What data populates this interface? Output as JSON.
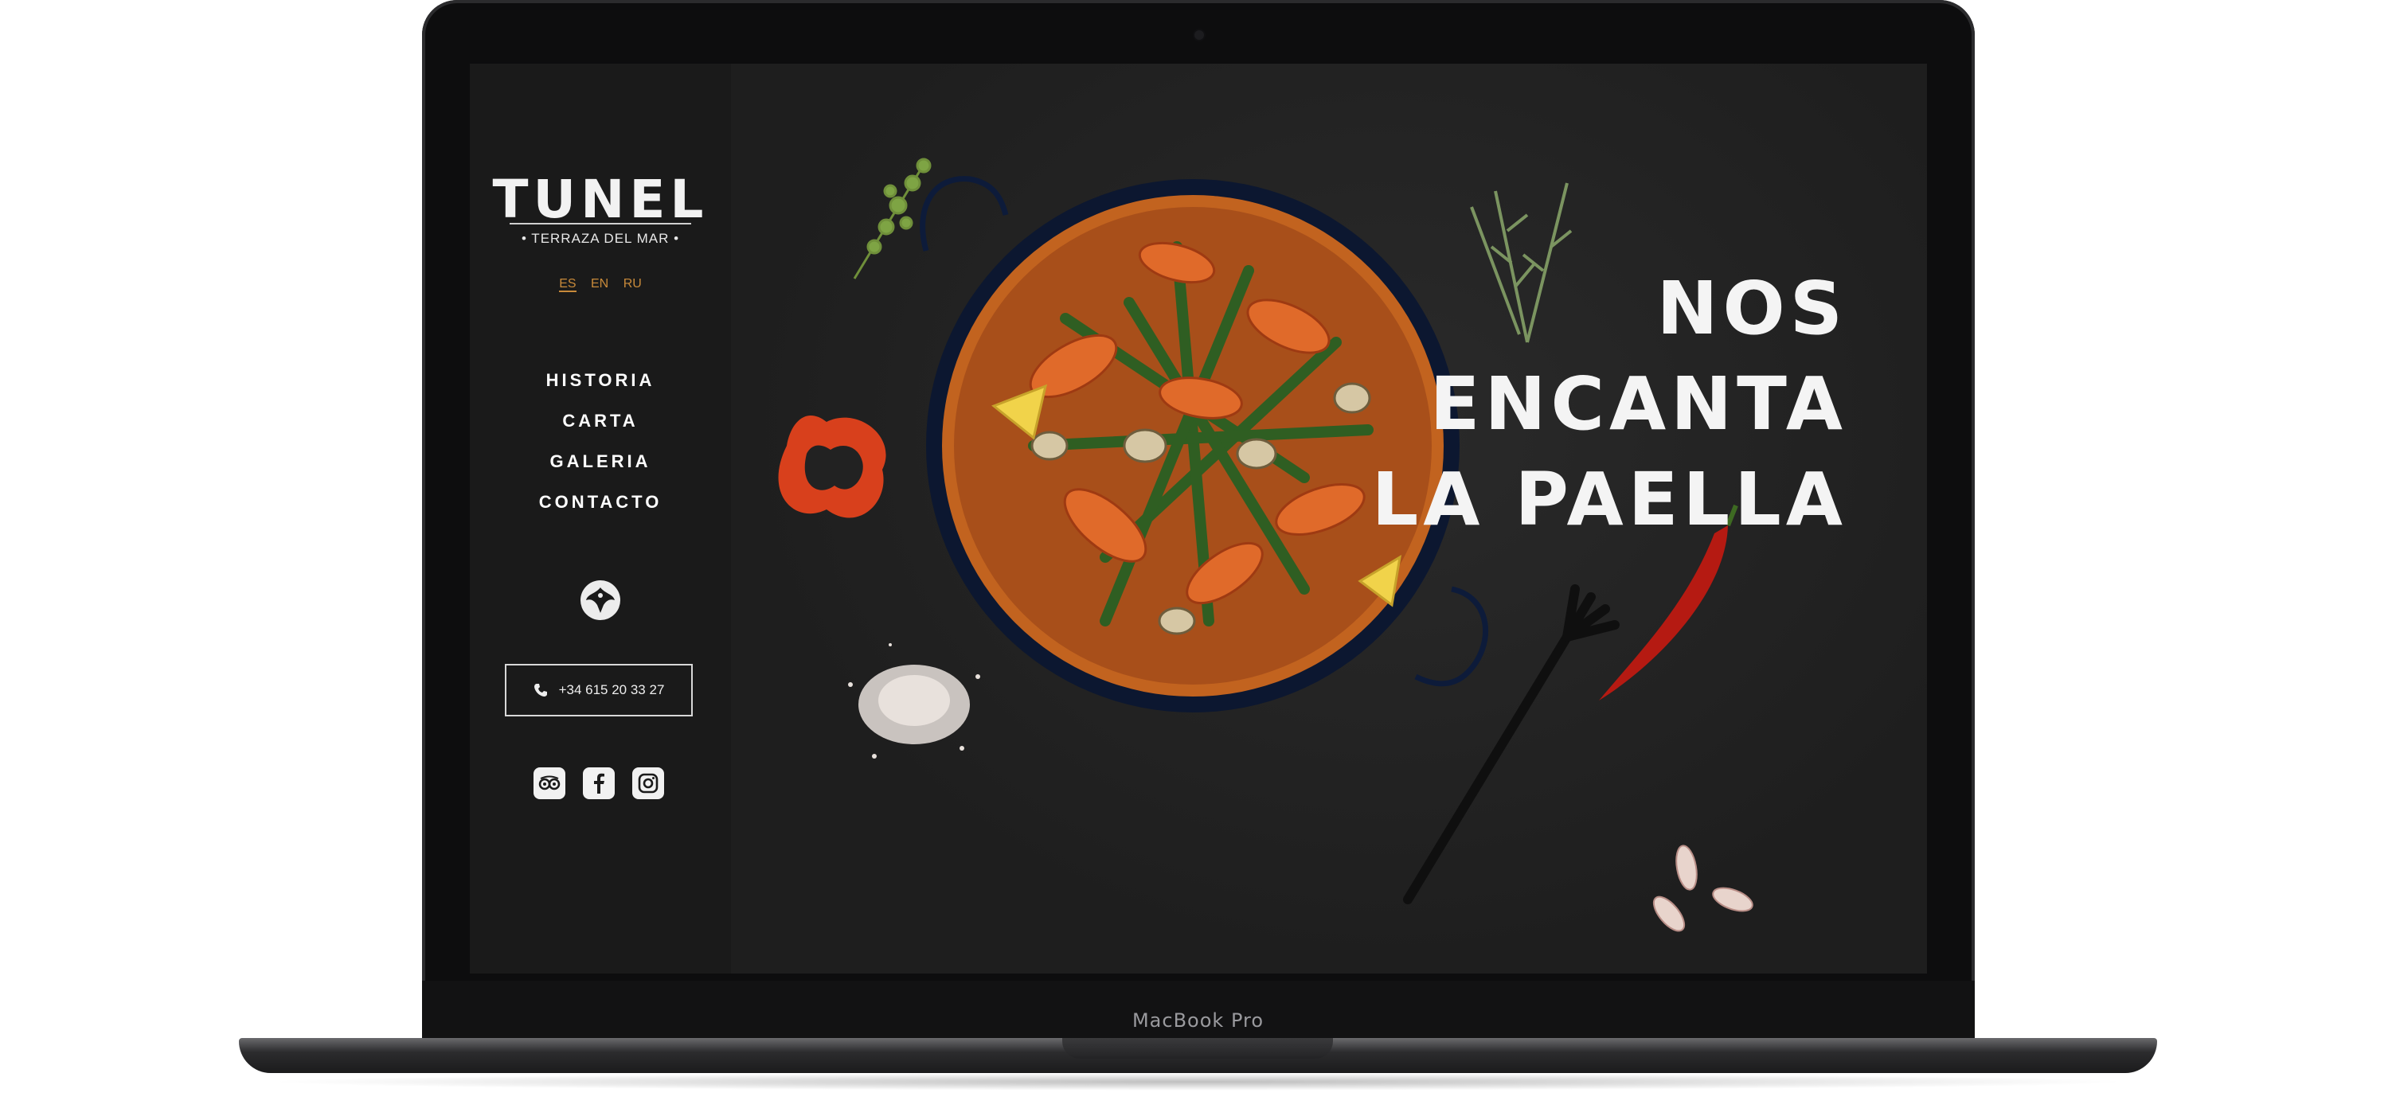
{
  "device": {
    "label": "MacBook Pro"
  },
  "sidebar": {
    "logo": "TUNEL",
    "tagline": "• TERRAZA DEL MAR •",
    "languages": [
      "ES",
      "EN",
      "RU"
    ],
    "active_language": "ES",
    "nav": [
      "HISTORIA",
      "CARTA",
      "GALERIA",
      "CONTACTO"
    ],
    "emblem": "bird-emblem-icon",
    "phone": "+34 615 20 33 27",
    "phone_icon": "phone-icon",
    "socials": [
      "tripadvisor-icon",
      "facebook-icon",
      "instagram-icon"
    ]
  },
  "hero": {
    "headline": [
      "NOS",
      "ENCANTA",
      "LA PAELLA"
    ],
    "images": [
      "paella-pan",
      "thyme-sprig",
      "rosemary-sprig",
      "red-pepper-ring",
      "salt-pile",
      "fork",
      "chili-pepper",
      "garlic-cloves"
    ]
  },
  "colors": {
    "accent": "#c88a3a",
    "sidebar_bg": "#1a1a1a",
    "hero_bg": "#222222",
    "text": "#ffffff"
  }
}
